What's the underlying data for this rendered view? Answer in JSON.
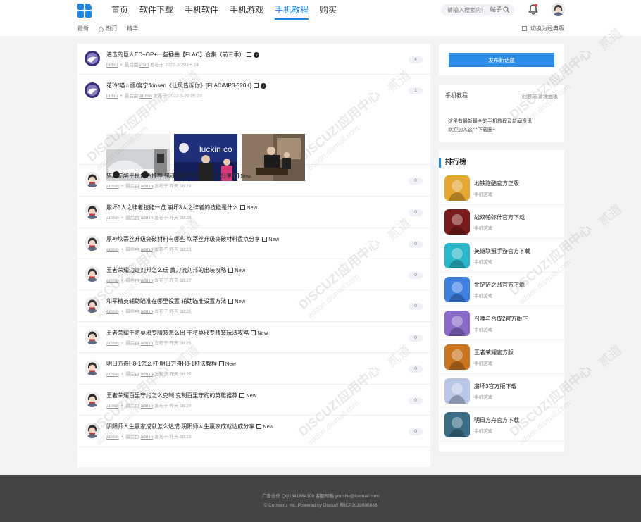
{
  "header": {
    "nav": [
      "首页",
      "软件下载",
      "手机软件",
      "手机游戏",
      "手机教程",
      "购买"
    ],
    "active_nav": 4,
    "search": {
      "placeholder": "请输入搜索内容",
      "scope": "帖子"
    },
    "subnav": [
      "最新",
      "热门",
      "精华"
    ],
    "classic_label": "切换为经典版"
  },
  "threads": [
    {
      "title": "进击的巨人ED+OP+一些插曲【FLAC】合集（前三季）",
      "author": "tudou",
      "last_prefix": "最后由",
      "last_user": "Pain",
      "posted": "发布于 2022-3-29 05:24",
      "count": "4",
      "new": "",
      "dot": true
    },
    {
      "title": "花玲/喵☆酱/宴宁/kinsen《让风告诉你》[FLAC/MP3-320K]",
      "author": "tudou",
      "last_prefix": "最后由",
      "last_user": "admin",
      "posted": "发布于 2022-3-29 05:23",
      "count": "1",
      "new": "",
      "dot": true
    },
    {
      "title": "猎魂觉醒平民角色推荐 猎魂觉醒平民角色推荐分享",
      "author": "admin",
      "last_prefix": "最后由",
      "last_user": "admin",
      "posted": "发布于 昨天 18:29",
      "count": "0",
      "new": "New",
      "dot": false
    },
    {
      "title": "崩坏3人之律者技能一览 崩坏3人之律者的技能是什么",
      "author": "admin",
      "last_prefix": "最后由",
      "last_user": "admin",
      "posted": "发布于 昨天 18:28",
      "count": "0",
      "new": "New",
      "dot": false
    },
    {
      "title": "原神坎蒂丝升级突破材料有哪些 坎蒂丝升级突破材料盘点分享",
      "author": "admin",
      "last_prefix": "最后由",
      "last_user": "admin",
      "posted": "发布于 昨天 18:28",
      "count": "0",
      "new": "New",
      "dot": false
    },
    {
      "title": "王者荣耀边迩刘邦怎么玩 黄刀流刘邦的出装攻略",
      "author": "admin",
      "last_prefix": "最后由",
      "last_user": "admin",
      "posted": "发布于 昨天 18:27",
      "count": "0",
      "new": "New",
      "dot": false
    },
    {
      "title": "和平精英辅助瞄准在哪里设置 辅助瞄准设置方法",
      "author": "admin",
      "last_prefix": "最后由",
      "last_user": "admin",
      "posted": "发布于 昨天 18:26",
      "count": "0",
      "new": "New",
      "dot": false
    },
    {
      "title": "王者荣耀干将莫邪专精装怎么出 干将莫邪专精装玩法攻略",
      "author": "admin",
      "last_prefix": "最后由",
      "last_user": "admin",
      "posted": "发布于 昨天 18:26",
      "count": "0",
      "new": "New",
      "dot": false
    },
    {
      "title": "明日方舟H8-1怎么打 明日方舟H8-1打法教程",
      "author": "admin",
      "last_prefix": "最后由",
      "last_user": "admin",
      "posted": "发布于 昨天 18:25",
      "count": "0",
      "new": "New",
      "dot": false
    },
    {
      "title": "王者荣耀百里守约怎么克制 克制百里守约的英雄推荐",
      "author": "admin",
      "last_prefix": "最后由",
      "last_user": "admin",
      "posted": "发布于 昨天 18:24",
      "count": "0",
      "new": "New",
      "dot": false
    },
    {
      "title": "阴阳师人生赢家成就怎么达成 阴阳师人生赢家成就达成分享",
      "author": "admin",
      "last_prefix": "最后由",
      "last_user": "admin",
      "posted": "发布于 昨天 18:23",
      "count": "0",
      "new": "New",
      "dot": false
    }
  ],
  "thumb_text": "luckin co",
  "sidebar": {
    "post_button": "发布新话题",
    "forum_title": "手机教程",
    "links": "回收站 管理面板",
    "desc1": "这里有最新最全的手机教程及新闻资讯",
    "desc2": "欢迎加入这个下载圈~",
    "rank_title": "排行榜",
    "rank": [
      {
        "name": "地铁跑酷官方正版",
        "cat": "手机游戏",
        "color": "#e4a72f"
      },
      {
        "name": "战双帕弥什官方下载",
        "cat": "手机游戏",
        "color": "#7a1c1c"
      },
      {
        "name": "英雄联盟手游官方下载",
        "cat": "手机游戏",
        "color": "#2bb7c9"
      },
      {
        "name": "金铲铲之战官方下载",
        "cat": "手机游戏",
        "color": "#3e7fe0"
      },
      {
        "name": "召唤与合成2官方版下",
        "cat": "手机游戏",
        "color": "#8b6bc9"
      },
      {
        "name": "王者荣耀官方版",
        "cat": "手机游戏",
        "color": "#c9741f"
      },
      {
        "name": "崩坏3官方版下载",
        "cat": "手机游戏",
        "color": "#b9c6e6"
      },
      {
        "name": "明日方舟官方下载",
        "cat": "手机游戏",
        "color": "#3a6c86"
      }
    ]
  },
  "footer": {
    "line1": "广告合作 QQ1841884100 客服邮箱 youshu@foxmail.com",
    "line2": "© Comsenz Inc. Powered by Discuz! 粤ICP2018000888"
  },
  "watermark": {
    "text1": "DISCUZ!应用中心",
    "text2": "addon.dismall.com",
    "text3": "贰道"
  }
}
